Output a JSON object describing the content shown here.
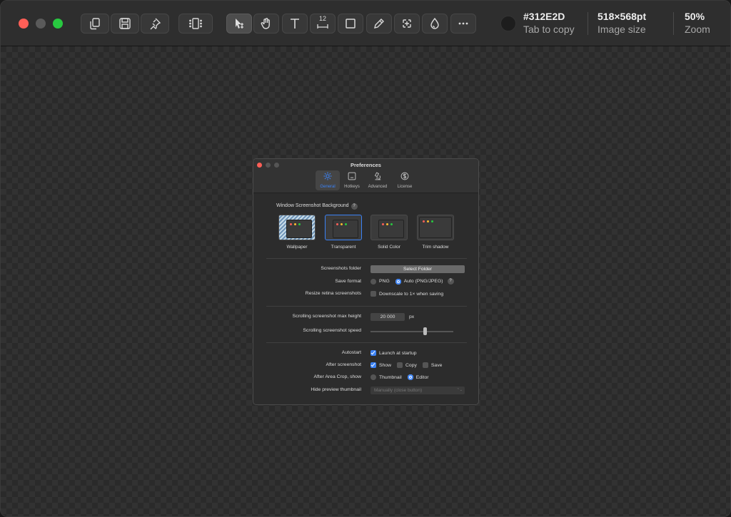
{
  "toolbar": {
    "color_hex": "#312E2D",
    "color_hint": "Tab to copy",
    "image_size": "518×568pt",
    "image_size_label": "Image size",
    "zoom": "50%",
    "zoom_label": "Zoom",
    "text_size_badge": "12"
  },
  "prefs": {
    "title": "Preferences",
    "tabs": [
      {
        "label": "General",
        "active": true
      },
      {
        "label": "Hotkeys",
        "active": false
      },
      {
        "label": "Advanced",
        "active": false
      },
      {
        "label": "License",
        "active": false
      }
    ],
    "background_title": "Window Screenshot Background",
    "backgrounds": [
      "Wallpaper",
      "Transparent",
      "Solid Color",
      "Trim shadow"
    ],
    "selected_background": "Transparent",
    "folder_label": "Screenshots folder",
    "folder_button": "Select Folder",
    "format_label": "Save format",
    "format_png": "PNG",
    "format_auto": "Auto (PNG/JPEG)",
    "resize_label": "Resize retina screenshots",
    "resize_option": "Downscale to 1× when saving",
    "scroll_height_label": "Scrolling screenshot max height",
    "scroll_height_value": "20 000",
    "scroll_height_unit": "px",
    "scroll_speed_label": "Scrolling screenshot speed",
    "scroll_speed_level": 0.66,
    "autostart_label": "Autostart",
    "autostart_option": "Launch at startup",
    "after_label": "After screenshot",
    "after_show": "Show",
    "after_copy": "Copy",
    "after_save": "Save",
    "crop_label": "After Area Crop, show",
    "crop_thumbnail": "Thumbnail",
    "crop_editor": "Editor",
    "hide_label": "Hide preview thumbnail",
    "hide_value": "Manually (close button)"
  }
}
